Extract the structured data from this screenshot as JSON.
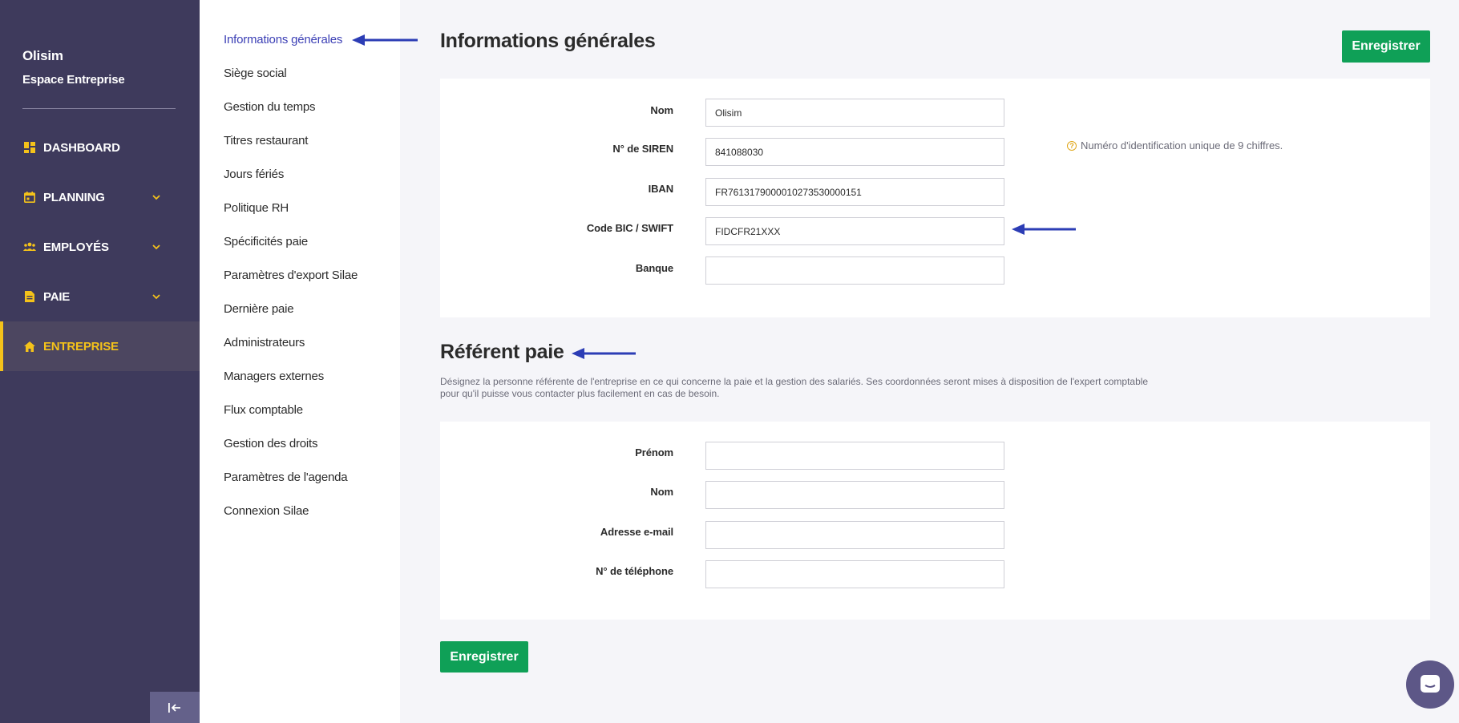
{
  "sidebar": {
    "company": "Olisim",
    "space": "Espace Entreprise",
    "items": [
      {
        "label": "DASHBOARD",
        "icon": "grid-icon"
      },
      {
        "label": "PLANNING",
        "icon": "calendar-icon"
      },
      {
        "label": "EMPLOYÉS",
        "icon": "people-icon"
      },
      {
        "label": "PAIE",
        "icon": "document-icon"
      },
      {
        "label": "ENTREPRISE",
        "icon": "home-icon"
      }
    ],
    "active": "ENTREPRISE"
  },
  "submenu": {
    "items": [
      "Informations générales",
      "Siège social",
      "Gestion du temps",
      "Titres restaurant",
      "Jours fériés",
      "Politique RH",
      "Spécificités paie",
      "Paramètres d'export Silae",
      "Dernière paie",
      "Administrateurs",
      "Managers externes",
      "Flux comptable",
      "Gestion des droits",
      "Paramètres de l'agenda",
      "Connexion Silae"
    ]
  },
  "main": {
    "title": "Informations générales",
    "save_label": "Enregistrer",
    "general": {
      "fields": [
        {
          "label": "Nom",
          "value": "Olisim"
        },
        {
          "label": "N° de SIREN",
          "value": "841088030"
        },
        {
          "label": "IBAN",
          "value": "FR7613179000010273530000151"
        },
        {
          "label": "Code BIC / SWIFT",
          "value": "FIDCFR21XXX"
        },
        {
          "label": "Banque",
          "value": ""
        }
      ],
      "siren_hint": "Numéro d'identification unique de 9 chiffres."
    },
    "referent": {
      "title": "Référent paie",
      "description": "Désignez la personne référente de l'entreprise en ce qui concerne la paie et la gestion des salariés. Ses coordonnées seront mises à disposition de l'expert comptable pour qu'il puisse vous contacter plus facilement en cas de besoin.",
      "fields": [
        {
          "label": "Prénom",
          "value": ""
        },
        {
          "label": "Nom",
          "value": ""
        },
        {
          "label": "Adresse e-mail",
          "value": ""
        },
        {
          "label": "N° de téléphone",
          "value": ""
        }
      ]
    },
    "bottom_save_label": "Enregistrer"
  },
  "colors": {
    "sidebar_bg": "#3e3a5c",
    "accent_yellow": "#f4c21a",
    "primary_green": "#0fa057",
    "link_blue": "#3b3fb5",
    "annotation_arrow": "#2c3db5"
  }
}
